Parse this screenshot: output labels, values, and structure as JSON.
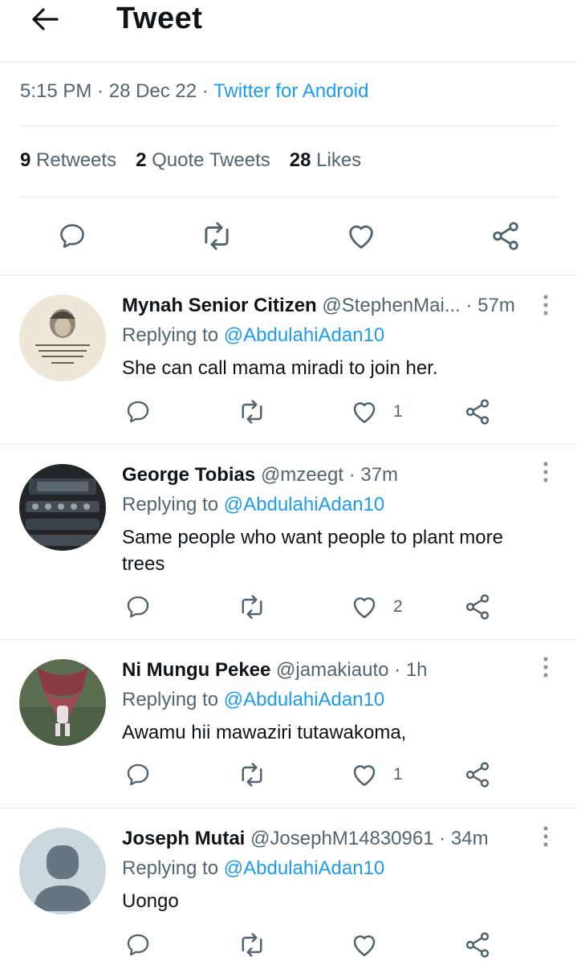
{
  "header": {
    "title": "Tweet"
  },
  "meta": {
    "time": "5:15 PM",
    "sep1": " · ",
    "date": "28 Dec 22",
    "sep2": " · ",
    "source": "Twitter for Android"
  },
  "stats": {
    "retweets_count": "9",
    "retweets_label": "Retweets",
    "quotes_count": "2",
    "quotes_label": "Quote Tweets",
    "likes_count": "28",
    "likes_label": "Likes"
  },
  "replies": [
    {
      "name": "Mynah Senior Citizen",
      "handle": "@StephenMai...",
      "time": " · 57m",
      "replying_label": "Replying to ",
      "replying_to": "@AbdulahiAdan10",
      "text": "She can call mama miradi to join her.",
      "likes": "1",
      "avatar_text": "\"Politicians and Diapers must be Changed often, and for the same reason.\" -Mark Twain"
    },
    {
      "name": "George Tobias",
      "handle": "@mzeegt",
      "time": " · 37m",
      "replying_label": "Replying to ",
      "replying_to": "@AbdulahiAdan10",
      "text": "Same people who want people to plant more trees",
      "likes": "2"
    },
    {
      "name": "Ni Mungu Pekee",
      "handle": "@jamakiauto",
      "time": " · 1h",
      "replying_label": "Replying to ",
      "replying_to": "@AbdulahiAdan10",
      "text": "Awamu hii mawaziri tutawakoma,",
      "likes": "1"
    },
    {
      "name": "Joseph Mutai",
      "handle": "@JosephM14830961",
      "time": " · 34m",
      "replying_label": "Replying to ",
      "replying_to": "@AbdulahiAdan10",
      "text": "Uongo",
      "likes": ""
    }
  ],
  "colors": {
    "accent": "#1d9bf0",
    "secondary_text": "#536471",
    "primary_text": "#0f1419",
    "divider": "#e6e9ec"
  }
}
